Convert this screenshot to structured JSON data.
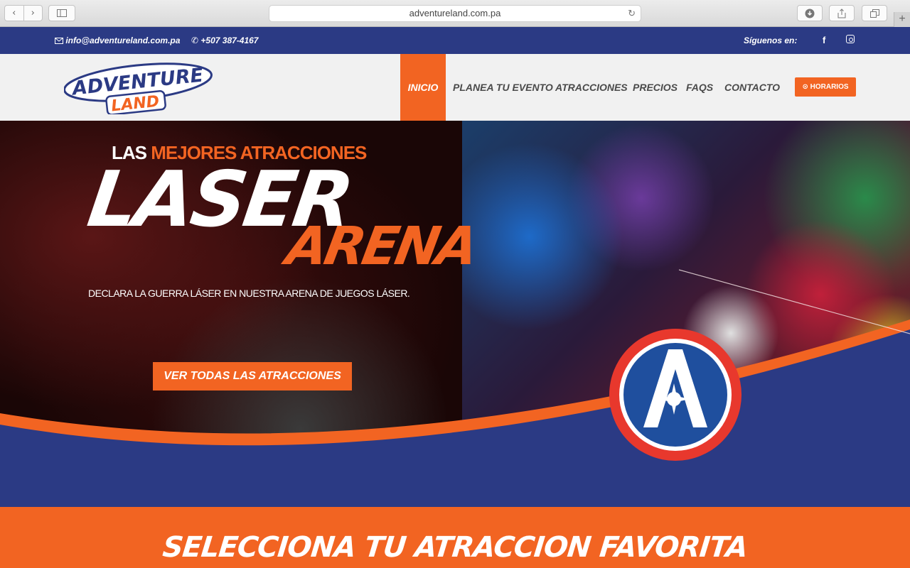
{
  "browser": {
    "url": "adventureland.com.pa"
  },
  "topbar": {
    "email": "info@adventureland.com.pa",
    "phone": "+507 387-4167",
    "follow_label": "Síguenos en:"
  },
  "brand": {
    "logo_line1": "ADVENTURE",
    "logo_line2": "LAND"
  },
  "nav": {
    "items": [
      {
        "label": "INICIO",
        "active": true
      },
      {
        "label": "PLANEA TU EVENTO",
        "active": false
      },
      {
        "label": "ATRACCIONES",
        "active": false
      },
      {
        "label": "PRECIOS",
        "active": false
      },
      {
        "label": "FAQS",
        "active": false
      },
      {
        "label": "CONTACTO",
        "active": false
      }
    ],
    "horarios_label": "HORARIOS"
  },
  "hero": {
    "kicker_plain": "LAS ",
    "kicker_accent": "MEJORES ATRACCIONES",
    "title_main": "LASER",
    "title_sub": "ARENA",
    "tagline": "DECLARA LA GUERRA LÁSER EN NUESTRA ARENA DE JUEGOS LÁSER.",
    "cta_label": "VER TODAS LAS ATRACCIONES"
  },
  "section": {
    "title": "SELECCIONA  TU ATRACCION FAVORITA"
  },
  "colors": {
    "navy": "#2b3a84",
    "orange": "#f26422",
    "header_bg": "#f1f1f1",
    "badge_red": "#e8382d",
    "badge_blue": "#1f4f9e"
  },
  "icons": {
    "email": "envelope-icon",
    "phone": "phone-icon",
    "facebook": "facebook-icon",
    "instagram": "instagram-icon",
    "horarios": "clock-icon"
  }
}
